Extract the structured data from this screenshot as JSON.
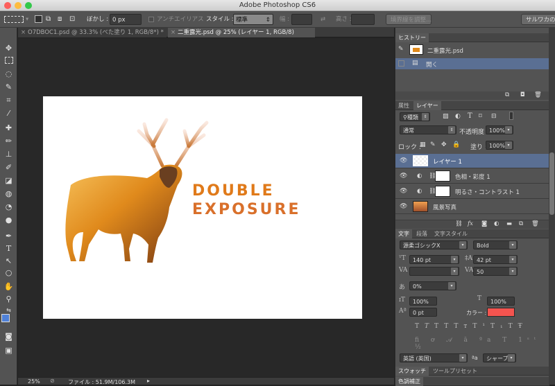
{
  "app_title": "Adobe Photoshop CS6",
  "options": {
    "feather_label": "ぼかし :",
    "feather_value": "0 px",
    "antialias_label": "アンチエイリアス",
    "style_label": "スタイル :",
    "style_value": "標準",
    "width_label": "幅 :",
    "height_label": "高さ :",
    "refine_edge_label": "境界線を調整...",
    "workspace_label": "サルワカの基"
  },
  "tabs": [
    {
      "label": "O7DBOC1.psd @ 33.3% (べた塗り 1, RGB/8*) *"
    },
    {
      "label": "二重露光.psd @ 25% (レイヤー 1, RGB/8)"
    }
  ],
  "document": {
    "title_line1": "DOUBLE",
    "title_line2": "EXPOSURE"
  },
  "status": {
    "zoom": "25%",
    "file_info": "ファイル : 51.9M/106.3M"
  },
  "history": {
    "tab": "ヒストリー",
    "snapshot": "二重露光.psd",
    "items": [
      {
        "label": "開く"
      }
    ]
  },
  "layers": {
    "tab_properties": "属性",
    "tab_layers": "レイヤー",
    "filter_kind": "種類",
    "blend_mode": "通常",
    "opacity_label": "不透明度 :",
    "opacity": "100%",
    "lock_label": "ロック :",
    "fill_label": "塗り :",
    "fill": "100%",
    "items": [
      {
        "name": "レイヤー 1"
      },
      {
        "name": "色相・彩度 1"
      },
      {
        "name": "明るさ・コントラスト 1"
      },
      {
        "name": "風景写真"
      }
    ]
  },
  "character": {
    "tab_char": "文字",
    "tab_para": "段落",
    "tab_charstyle": "文字スタイル",
    "font_family": "源柔ゴシックX",
    "font_style": "Bold",
    "font_size": "140 pt",
    "leading": "42 pt",
    "tracking": "50",
    "tsume": "0%",
    "vscale": "100%",
    "hscale": "100%",
    "baseline": "0 pt",
    "color_label": "カラー :",
    "color": "#f4544f",
    "language": "英語 (英国)",
    "antialias": "シャープ",
    "aa_label": "ªa"
  },
  "bottom_panels": {
    "swatches": "スウォッチ",
    "tool_presets": "ツールプリセット",
    "adjustments": "色調補正"
  }
}
